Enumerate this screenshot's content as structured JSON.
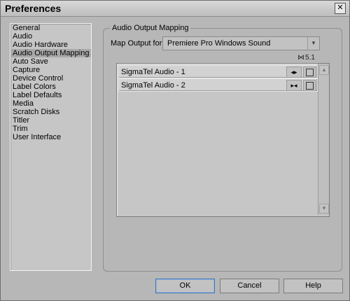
{
  "window": {
    "title": "Preferences"
  },
  "titlebar": {
    "close_icon": "close-icon"
  },
  "categories": [
    {
      "label": "General"
    },
    {
      "label": "Audio"
    },
    {
      "label": "Audio Hardware"
    },
    {
      "label": "Audio Output Mapping",
      "selected": true
    },
    {
      "label": "Auto Save"
    },
    {
      "label": "Capture"
    },
    {
      "label": "Device Control"
    },
    {
      "label": "Label Colors"
    },
    {
      "label": "Label Defaults"
    },
    {
      "label": "Media"
    },
    {
      "label": "Scratch Disks"
    },
    {
      "label": "Titler"
    },
    {
      "label": "Trim"
    },
    {
      "label": "User Interface"
    }
  ],
  "group": {
    "title": "Audio Output Mapping",
    "map_label": "Map Output for:",
    "selected_output": "Premiere Pro Windows Sound",
    "col_stereo_icon": "stereo-icon",
    "col_51": "5.1",
    "rows": [
      {
        "label": "SigmaTel Audio - 1",
        "stereo_icon": "speaker-left-icon",
        "surround_icon": "surround-icon"
      },
      {
        "label": "SigmaTel Audio - 2",
        "stereo_icon": "speaker-right-icon",
        "surround_icon": "surround-icon"
      }
    ]
  },
  "buttons": {
    "ok": "OK",
    "cancel": "Cancel",
    "help": "Help"
  },
  "colors": {
    "background": "#b7b7b7",
    "selection": "#a8a8a8",
    "default_button_border": "#3e74b7"
  }
}
